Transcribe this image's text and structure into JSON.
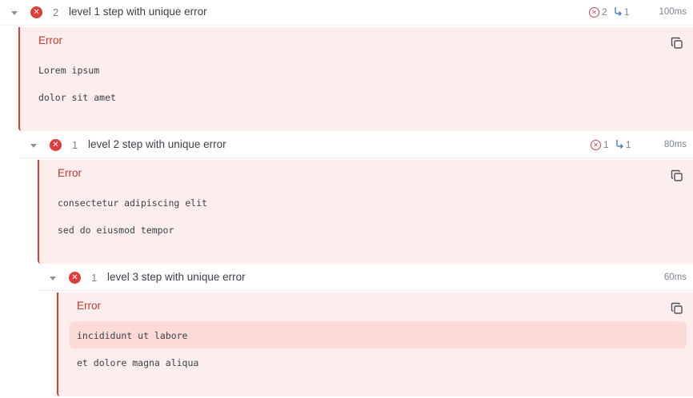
{
  "steps": [
    {
      "index": "2",
      "title": "level 1 step with unique error",
      "error_count": "2",
      "child_count": "1",
      "duration": "100ms",
      "error_label": "Error",
      "lines": [
        "Lorem ipsum",
        "dolor sit amet"
      ]
    },
    {
      "index": "1",
      "title": "level 2 step with unique error",
      "error_count": "1",
      "child_count": "1",
      "duration": "80ms",
      "error_label": "Error",
      "lines": [
        "consectetur adipiscing elit",
        "sed do eiusmod tempor"
      ]
    },
    {
      "index": "1",
      "title": "level 3 step with unique error",
      "duration": "60ms",
      "error_label": "Error",
      "lines": [
        "incididunt ut labore",
        "et dolore magna aliqua"
      ]
    }
  ],
  "icons": {
    "status": "error-x-icon",
    "expand": "caret-down-icon",
    "copy": "copy-icon",
    "error_count": "error-circle-icon",
    "child_count": "child-arrow-icon"
  },
  "colors": {
    "error": "#e03b3b",
    "error_bg": "#fdeeee",
    "error_text": "#c8372d"
  }
}
